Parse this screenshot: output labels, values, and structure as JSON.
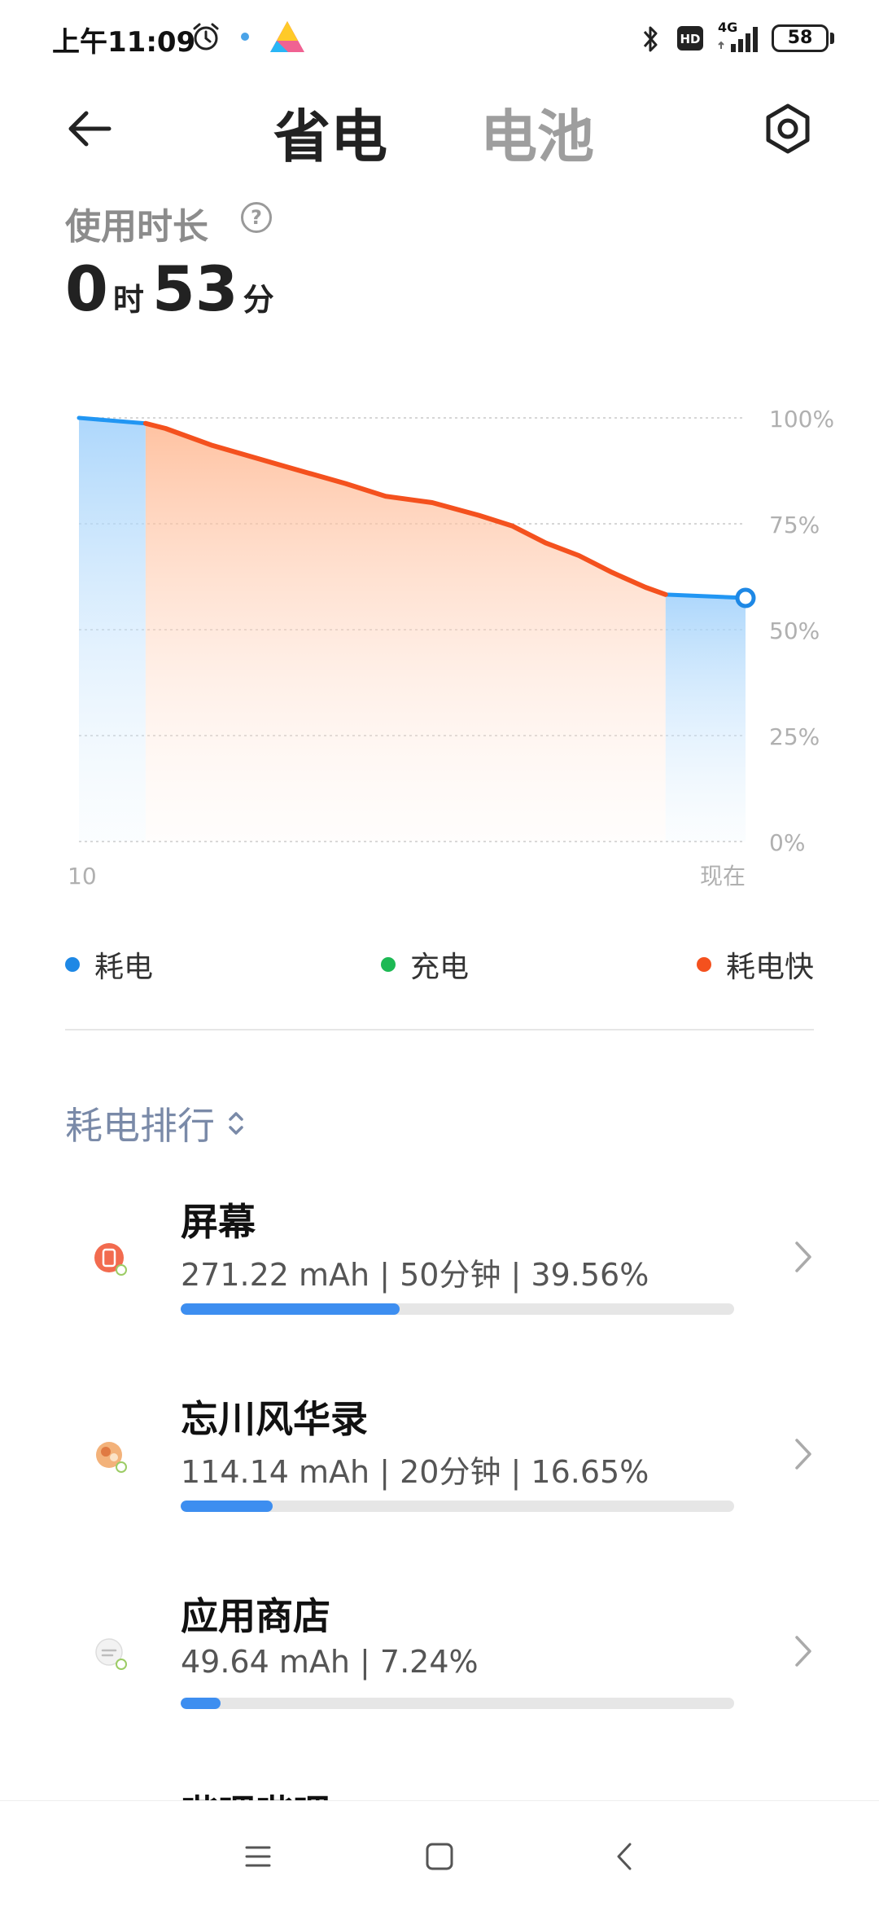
{
  "status_bar": {
    "time": "上午11:09",
    "network": "4G",
    "battery": "58"
  },
  "header": {
    "tabs": [
      {
        "label": "省电",
        "active": true
      },
      {
        "label": "电池",
        "active": false
      }
    ]
  },
  "usage": {
    "label": "使用时长",
    "hours": "0",
    "hour_unit": "时",
    "minutes": "53",
    "minute_unit": "分"
  },
  "chart_data": {
    "type": "area",
    "x": [
      0,
      10,
      15,
      25,
      35,
      45,
      55,
      65,
      70,
      75,
      80,
      85,
      90,
      100
    ],
    "x_tick_labels": [
      "10",
      "现在"
    ],
    "y_tick_labels": [
      "100%",
      "75%",
      "50%",
      "25%",
      "0%"
    ],
    "ylim": [
      0,
      100
    ],
    "grid": true,
    "series": [
      {
        "name": "耗电",
        "color": "#2196f3",
        "points": [
          [
            0,
            100
          ],
          [
            10,
            98.7
          ],
          [
            88,
            58.3
          ],
          [
            100,
            57.5
          ]
        ]
      },
      {
        "name": "耗电快",
        "color": "#f4511e",
        "points": [
          [
            10,
            98.7
          ],
          [
            13,
            97.5
          ],
          [
            20,
            93.5
          ],
          [
            31,
            88.5
          ],
          [
            40,
            84.5
          ],
          [
            46,
            81.5
          ],
          [
            53,
            80
          ],
          [
            60,
            77
          ],
          [
            65,
            74.5
          ],
          [
            70,
            70.5
          ],
          [
            75,
            67.5
          ],
          [
            80,
            63.5
          ],
          [
            85,
            60
          ],
          [
            88,
            58.3
          ]
        ]
      }
    ],
    "current_point": [
      100,
      57.5
    ]
  },
  "legend": [
    {
      "label": "耗电",
      "color": "#1e88e5"
    },
    {
      "label": "充电",
      "color": "#1db954"
    },
    {
      "label": "耗电快",
      "color": "#f4511e"
    }
  ],
  "ranking": {
    "title": "耗电排行",
    "apps": [
      {
        "name": "屏幕",
        "detail": "271.22 mAh | 50分钟 | 39.56%",
        "percent": 39.56
      },
      {
        "name": "忘川风华录",
        "detail": "114.14 mAh | 20分钟 | 16.65%",
        "percent": 16.65
      },
      {
        "name": "应用商店",
        "detail": "49.64 mAh | 7.24%",
        "percent": 7.24
      }
    ],
    "partial_app_name": "哔哩哔哩"
  },
  "icons": [
    "alarm-icon",
    "bluetooth-icon",
    "hd-icon",
    "signal-icon",
    "back-arrow-icon",
    "gear-icon",
    "help-icon",
    "sort-icon",
    "chevron-right-icon",
    "menu-icon",
    "home-icon",
    "nav-back-icon"
  ]
}
